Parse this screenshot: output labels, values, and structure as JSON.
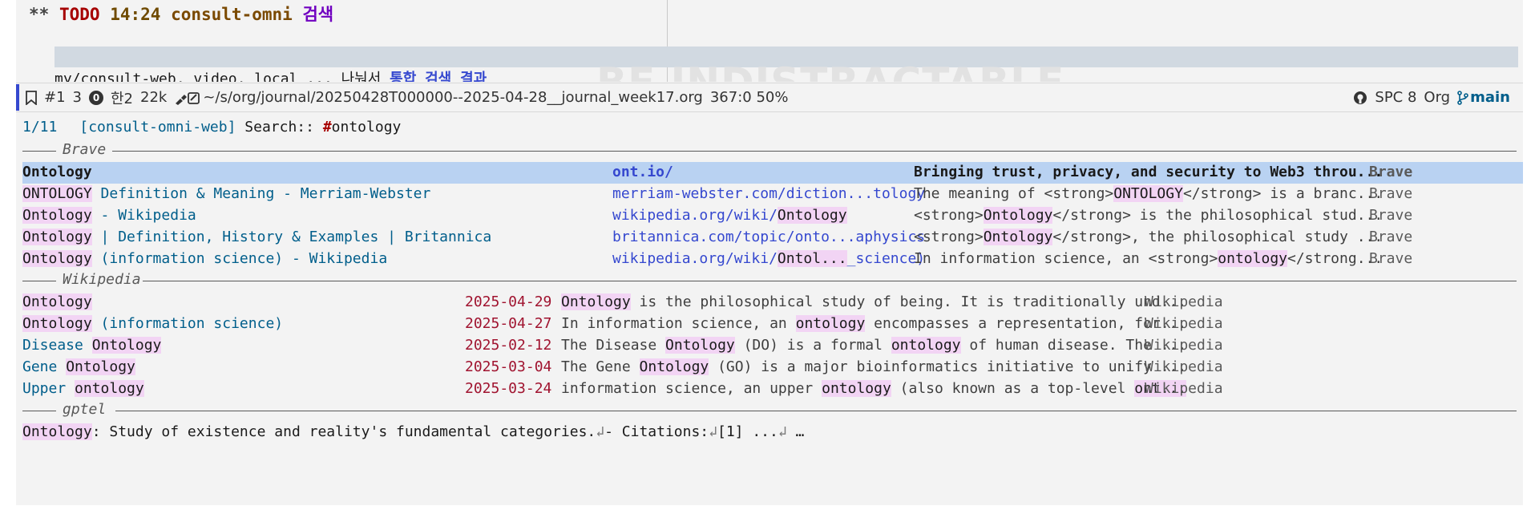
{
  "org": {
    "stars": "**",
    "todo": "TODO",
    "time": "14:24",
    "title": "consult-omni",
    "title_korean": "검색",
    "body_text": "my/consult-web, video, local ... 나눠서",
    "body_link": "통합 검색 결과",
    "watermark": "BE INDISTRACTABLE"
  },
  "modeline": {
    "window": "#1",
    "workspace": "3",
    "errors": "0",
    "input_method": "한2",
    "size": "22k",
    "path": "~/s/org/journal/20250428T000000--2025-04-28__journal_week17.org",
    "position": "367:0 50%",
    "leader": "SPC 8",
    "major_mode": "Org",
    "branch": "main",
    "icons": [
      "bookmark-icon",
      "info-zero-icon",
      "edit-file-icon",
      "github-icon",
      "git-branch-icon"
    ]
  },
  "minibuffer": {
    "count": "1/11",
    "source": "[consult-omni-web]",
    "prompt": "Search::",
    "query_hash": "#",
    "query": "ontology"
  },
  "groups": {
    "brave": {
      "label": "Brave",
      "results": [
        {
          "match": "Ontology",
          "title_rest": "",
          "url_pre": "ont.io/",
          "url_match": "",
          "url_post": "",
          "desc": "Bringing trust, privacy, and security to Web3 throu...",
          "source": "Brave"
        },
        {
          "match": "ONTOLOGY",
          "title_rest": " Definition & Meaning - Merriam-Webster",
          "url_pre": "merriam-webster.com/diction...tology",
          "url_match": "",
          "url_post": "",
          "desc_pre": "The meaning of <strong>",
          "desc_match": "ONTOLOGY",
          "desc_post": "</strong> is a branc...",
          "source": "Brave"
        },
        {
          "match": "Ontology",
          "title_rest": " - Wikipedia",
          "url_pre": "wikipedia.org/wiki/",
          "url_match": "Ontology",
          "url_post": "",
          "desc_pre": "<strong>",
          "desc_match": "Ontology",
          "desc_post": "</strong> is the philosophical stud...",
          "source": "Brave"
        },
        {
          "match": "Ontology",
          "title_rest": " | Definition, History & Examples | Britannica",
          "url_pre": "britannica.com/topic/onto...aphysics",
          "url_match": "",
          "url_post": "",
          "desc_pre": "<strong>",
          "desc_match": "Ontology",
          "desc_post": "</strong>, the philosophical study ...",
          "source": "Brave"
        },
        {
          "match": "Ontology",
          "title_rest": " (information science) - Wikipedia",
          "url_pre": "wikipedia.org/wiki/",
          "url_match": "Ontol...",
          "url_post": "_science)",
          "desc_pre": "In information science, an <strong>",
          "desc_match": "ontology",
          "desc_post": "</strong...",
          "source": "Brave"
        }
      ]
    },
    "wikipedia": {
      "label": "Wikipedia",
      "results": [
        {
          "title_pre": "",
          "match": "Ontology",
          "title_post": "",
          "date": "2025-04-29",
          "d1": "",
          "dm1": "Ontology",
          "d2": " is the philosophical study of being. It is traditionally und...",
          "dm2": "",
          "d3": "",
          "source": "Wikipedia"
        },
        {
          "title_pre": "",
          "match": "Ontology",
          "title_post": " (information science)",
          "date": "2025-04-27",
          "d1": "In information science, an ",
          "dm1": "ontology",
          "d2": " encompasses a representation, for...",
          "dm2": "",
          "d3": "",
          "source": "Wikipedia"
        },
        {
          "title_pre": "Disease ",
          "match": "Ontology",
          "title_post": "",
          "date": "2025-02-12",
          "d1": "The Disease ",
          "dm1": "Ontology",
          "d2": " (DO) is a formal ",
          "dm2": "ontology",
          "d3": " of human disease. The ...",
          "source": "Wikipedia"
        },
        {
          "title_pre": "Gene ",
          "match": "Ontology",
          "title_post": "",
          "date": "2025-03-04",
          "d1": "The Gene ",
          "dm1": "Ontology",
          "d2": " (GO) is a major bioinformatics initiative to unify ...",
          "dm2": "",
          "d3": "",
          "source": "Wikipedia"
        },
        {
          "title_pre": "Upper ",
          "match": "ontology",
          "title_post": "",
          "date": "2025-03-24",
          "d1": "information science, an upper ",
          "dm1": "ontology",
          "d2": " (also known as a top-level ",
          "dm2": "ont...",
          "d3": "",
          "source": "Wikipedia"
        }
      ]
    },
    "gptel": {
      "label": "gptel",
      "match": "Ontology",
      "text": ": Study of existence and reality's fundamental categories.",
      "cont1": "↲",
      "text2": "- Citations:",
      "cont2": "↲",
      "text3": "[1] ...",
      "cont3": "↲",
      "ellipsis": " …"
    }
  }
}
